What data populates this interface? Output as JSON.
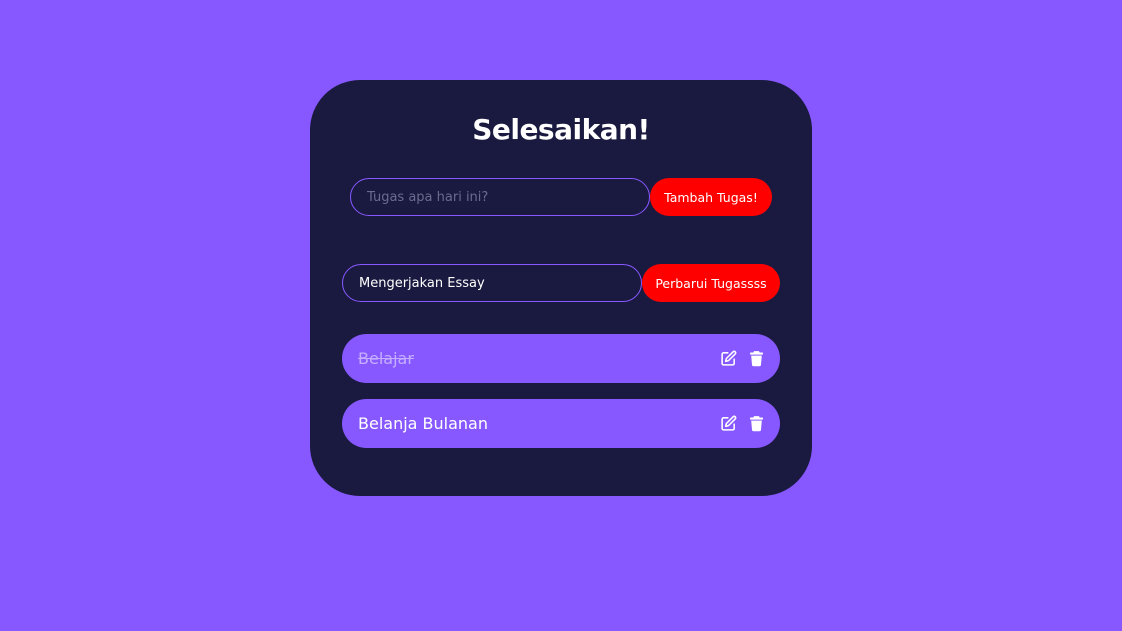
{
  "title": "Selesaikan!",
  "add_form": {
    "placeholder": "Tugas apa hari ini?",
    "value": "",
    "button_label": "Tambah Tugas!"
  },
  "edit_form": {
    "value": "Mengerjakan Essay",
    "button_label": "Perbarui Tugassss"
  },
  "todos": [
    {
      "label": "Belajar",
      "completed": true,
      "edit_icon": "pen-to-square-icon",
      "delete_icon": "trash-icon"
    },
    {
      "label": "Belanja Bulanan",
      "completed": false,
      "edit_icon": "pen-to-square-icon",
      "delete_icon": "trash-icon"
    }
  ],
  "colors": {
    "background": "#8758ff",
    "card": "#1a1a40",
    "button": "#ff0000",
    "item": "#8758ff"
  }
}
